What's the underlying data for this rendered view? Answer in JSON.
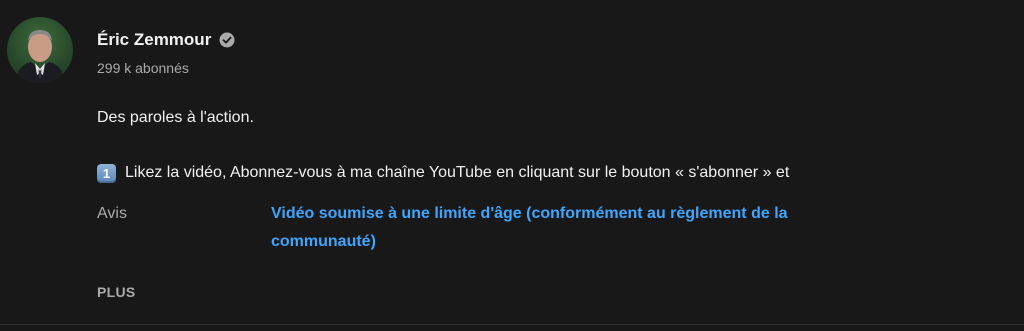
{
  "channel": {
    "name": "Éric Zemmour",
    "verified_icon": "verified-check-icon",
    "subscribers": "299 k abonnés",
    "avatar_icon": "channel-avatar"
  },
  "description": {
    "line1": "Des paroles à l'action.",
    "line2_keycap": "1",
    "line2_keycap_icon": "keycap-one-icon",
    "line2_text": "Likez la vidéo, Abonnez-vous à ma chaîne YouTube en cliquant sur le bouton « s'abonner » et"
  },
  "metadata": {
    "label": "Avis",
    "value": "Vidéo soumise à une limite d'âge (conformément au règlement de la communauté)"
  },
  "more_label": "PLUS",
  "colors": {
    "background": "#181818",
    "text": "#f1f1f1",
    "muted": "#aaaaaa",
    "link": "#3ea6ff"
  }
}
